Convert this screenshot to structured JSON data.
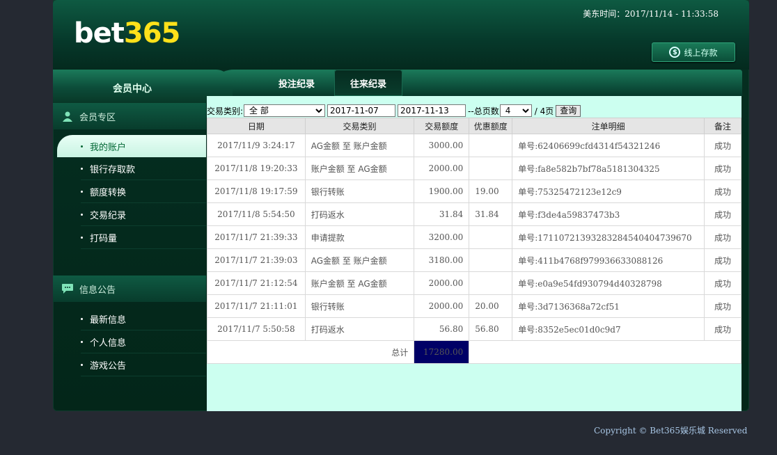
{
  "header": {
    "logo_part1": "bet",
    "logo_part2": "365",
    "time_label": "美东时间：2017/11/14 - 11:33:58",
    "deposit_label": "线上存款"
  },
  "member_tab": "会员中心",
  "tabs": [
    {
      "label": "投注纪录",
      "active": false
    },
    {
      "label": "往来纪录",
      "active": true
    }
  ],
  "sidebar": {
    "section1": {
      "title": "会员专区",
      "items": [
        {
          "label": "我的账户"
        },
        {
          "label": "银行存取款"
        },
        {
          "label": "额度转换"
        },
        {
          "label": "交易纪录"
        },
        {
          "label": "打码量"
        }
      ]
    },
    "section2": {
      "title": "信息公告",
      "items": [
        {
          "label": "最新信息"
        },
        {
          "label": "个人信息"
        },
        {
          "label": "游戏公告"
        }
      ]
    }
  },
  "filter": {
    "type_label": "交易类别:",
    "type_value": "全 部",
    "date_start": "2017-11-07",
    "date_end": "2017-11-13",
    "pages_label": "--总页数",
    "page_value": "4",
    "pages_total": "/ 4页",
    "query_label": "查询"
  },
  "table": {
    "headers": [
      "日期",
      "交易类别",
      "交易额度",
      "优惠额度",
      "注单明细",
      "备注"
    ],
    "rows": [
      [
        "2017/11/9 3:24:17",
        "AG金额 至 账户金额",
        "3000.00",
        "",
        "单号:62406699cfd4314f54321246",
        "成功"
      ],
      [
        "2017/11/8 19:20:33",
        "账户金额 至 AG金额",
        "2000.00",
        "",
        "单号:fa8e582b7bf78a5181304325",
        "成功"
      ],
      [
        "2017/11/8 19:17:59",
        "银行转账",
        "1900.00",
        "19.00",
        "单号:75325472123e12c9",
        "成功"
      ],
      [
        "2017/11/8 5:54:50",
        "打码返水",
        "31.84",
        "31.84",
        "单号:f3de4a59837473b3",
        "成功"
      ],
      [
        "2017/11/7 21:39:33",
        "申请提款",
        "3200.00",
        "",
        "单号:17110721393283284540404739670",
        "成功"
      ],
      [
        "2017/11/7 21:39:03",
        "AG金额 至 账户金额",
        "3180.00",
        "",
        "单号:411b4768f979936633088126",
        "成功"
      ],
      [
        "2017/11/7 21:12:54",
        "账户金额 至 AG金额",
        "2000.00",
        "",
        "单号:e0a9e54fd930794d40328798",
        "成功"
      ],
      [
        "2017/11/7 21:11:01",
        "银行转账",
        "2000.00",
        "20.00",
        "单号:3d7136368a72cf51",
        "成功"
      ],
      [
        "2017/11/7 5:50:58",
        "打码返水",
        "56.80",
        "56.80",
        "单号:8352e5ec01d0c9d7",
        "成功"
      ]
    ],
    "total_label": "总计",
    "total_value": "17280.00"
  },
  "copyright": "Copyright © Bet365娱乐城 Reserved"
}
